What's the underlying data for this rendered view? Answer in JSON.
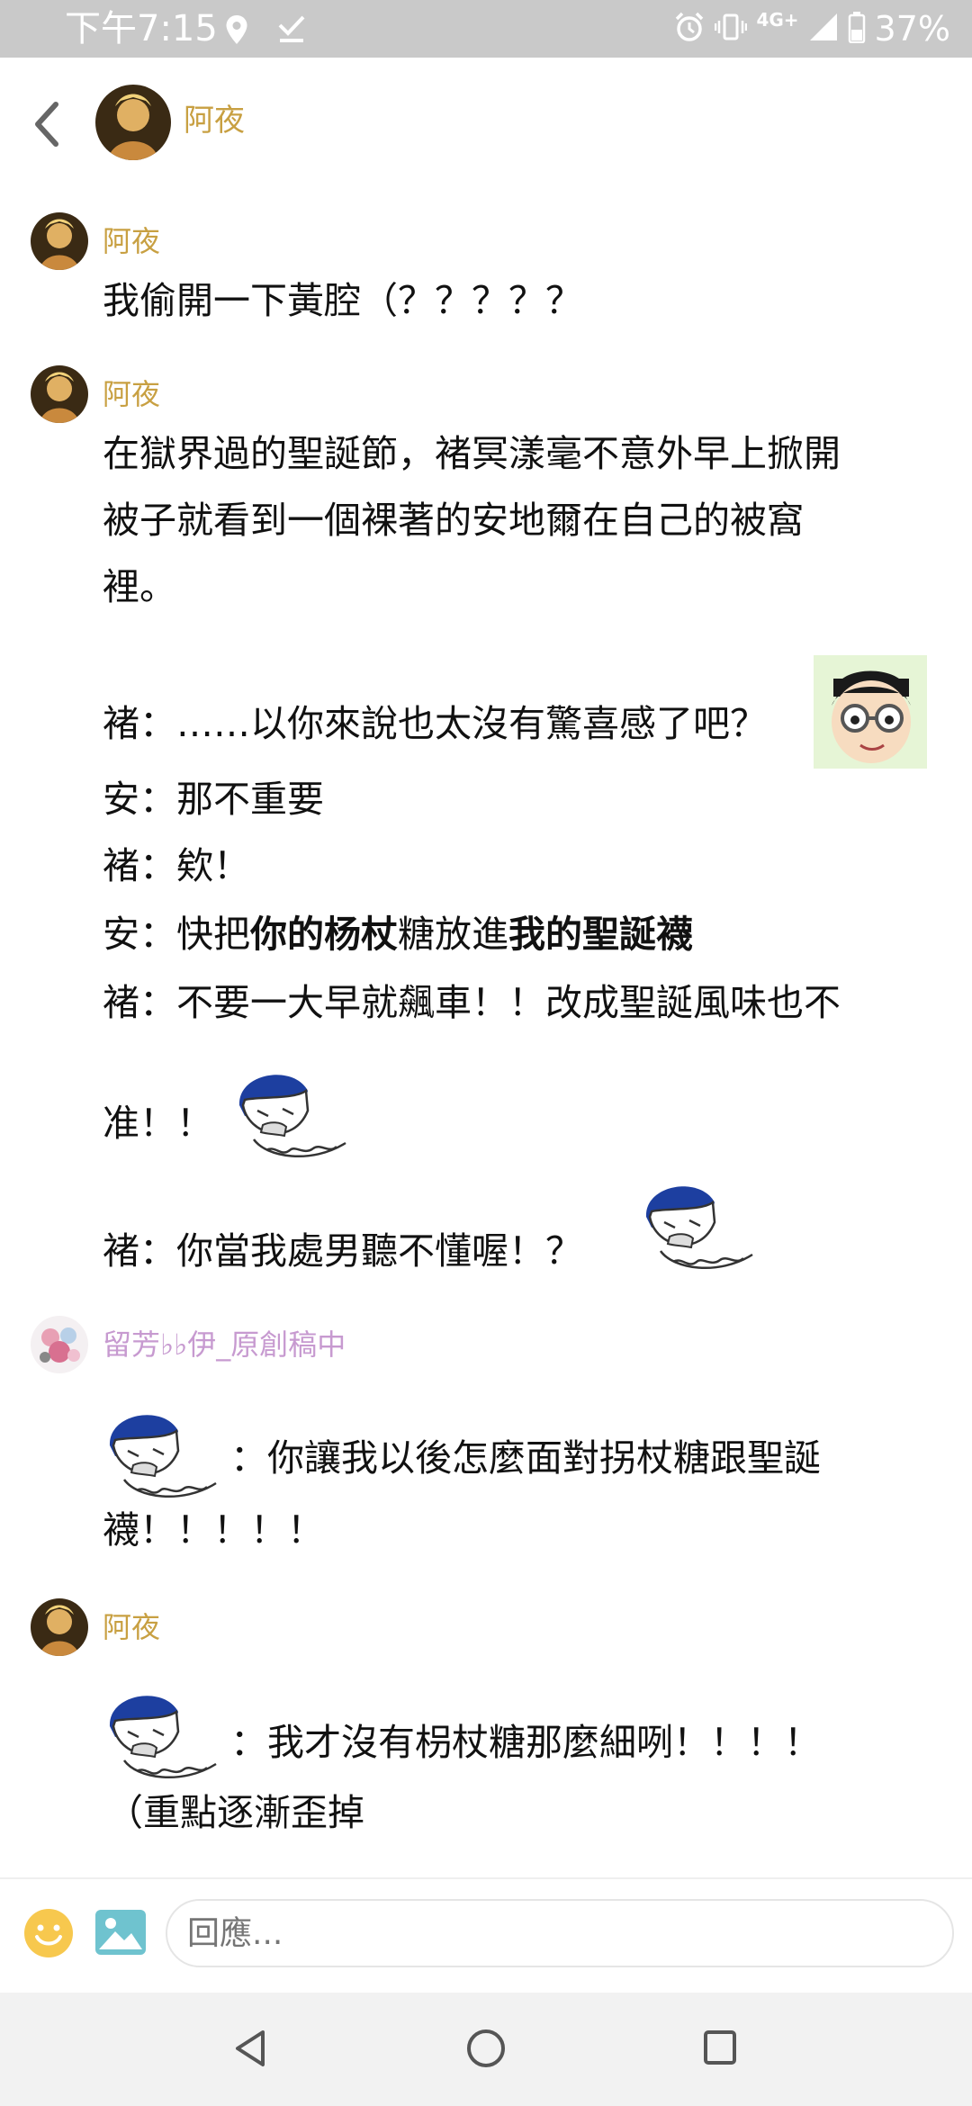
{
  "status_bar": {
    "time": "下午7:15",
    "network": "4G+",
    "battery": "37%"
  },
  "header": {
    "back_icon": "chevron-left-icon",
    "name": "阿夜"
  },
  "messages": [
    {
      "author": "阿夜",
      "lines": [
        "我偷開一下黃腔（？？？？？"
      ]
    },
    {
      "author": "阿夜",
      "lines": [
        "在獄界過的聖誕節，褚冥漾毫不意外早上掀開",
        "被子就看到一個裸著的安地爾在自己的被窩",
        "裡。",
        "褚：……以你來說也太沒有驚喜感了吧？",
        "安：那不重要",
        "褚：欸！",
        "安：快把",
        "褚：不要一大早就飆車！！改成聖誕風味也不",
        "准！！",
        "褚：你當我處男聽不懂喔！？"
      ],
      "bold_segments": {
        "a": "你的杨杖",
        "b": "糖放進",
        "c": "我的聖誕襪"
      }
    },
    {
      "author": "留芳♭♭伊_原創稿中",
      "lines": [
        "：你讓我以後怎麼面對拐杖糖跟聖誕",
        "襪！！！！！"
      ]
    },
    {
      "author": "阿夜",
      "lines": [
        "：我才沒有枴杖糖那麼細咧！！！！",
        "（重點逐漸歪掉"
      ]
    }
  ],
  "composer": {
    "placeholder": "回應...",
    "emoji_icon": "smile-icon",
    "image_icon": "image-icon"
  },
  "colors": {
    "author_gold": "#c8a042",
    "author_purple": "#c79ad0",
    "status_bar_bg": "#c9c9c9"
  }
}
